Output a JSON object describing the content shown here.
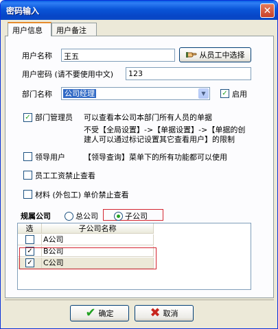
{
  "window": {
    "title": "密码输入",
    "close_glyph": "✕"
  },
  "tabs": [
    {
      "label": "用户信息",
      "active": true
    },
    {
      "label": "用户备注",
      "active": false
    }
  ],
  "form": {
    "username_label": "用户名称",
    "username_value": "王五",
    "pick_employee_button": "从员工中选择",
    "password_label": "用户密码 (请不要使用中文)",
    "password_value": "123",
    "department_label": "部门名称",
    "department_value": "公司经理",
    "enabled_label": "启用",
    "enabled_checked": true
  },
  "options": {
    "dept_manager_label": "部门管理员",
    "dept_manager_checked": true,
    "dept_manager_desc": "可以查看本公司本部门所有人员的单据",
    "dept_manager_note_line1": "不受【全局设置】->【单据设置】->【单据的创",
    "dept_manager_note_line2": "建人可以通过标记设置其它查看用户】的限制",
    "leader_label": "领导用户",
    "leader_checked": false,
    "leader_desc": "【领导查询】菜单下的所有功能都可以使用",
    "wage_label": "员工工资禁止查看",
    "wage_checked": false,
    "material_label": "材料 (外包工) 单价禁止查看",
    "material_checked": false
  },
  "company": {
    "label": "规属公司",
    "radio_head": "总公司",
    "radio_sub": "子公司",
    "selected": "子公司"
  },
  "grid": {
    "headers": [
      "选",
      "子公司名称"
    ],
    "rows": [
      {
        "checked": false,
        "name": "A公司"
      },
      {
        "checked": true,
        "name": "B公司"
      },
      {
        "checked": true,
        "name": "C公司"
      }
    ]
  },
  "buttons": {
    "ok": "确定",
    "cancel": "取消"
  },
  "colors": {
    "accent_red": "#d3242f",
    "check_green": "#21a121",
    "titlebar_blue": "#0a55d8"
  }
}
